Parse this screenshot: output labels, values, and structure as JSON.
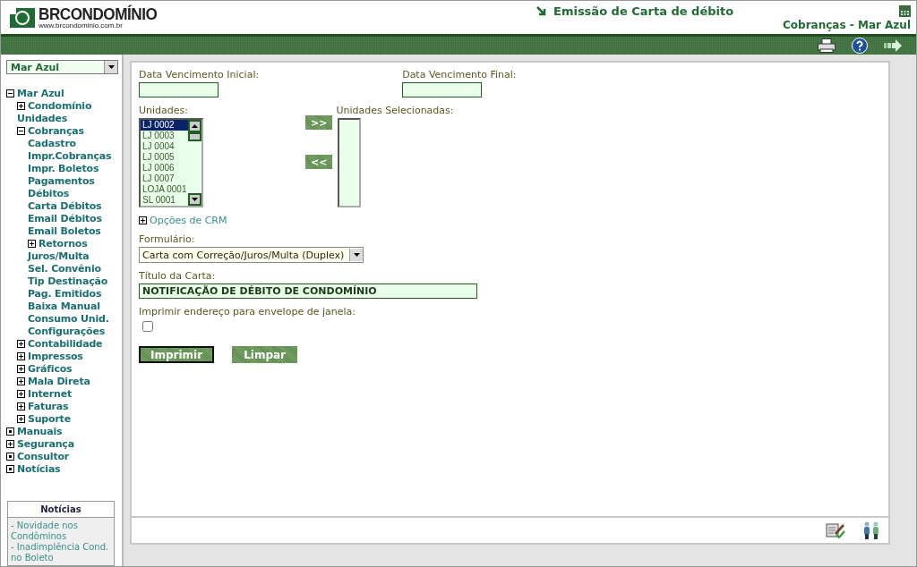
{
  "header": {
    "logo": "BRCONDOMÍNIO",
    "logo_url": "www.brcondominio.com.br",
    "title": "Emissão de Carta de débito",
    "subtitle": "Cobranças - Mar Azul"
  },
  "sidebar": {
    "condo_select": "Mar Azul",
    "tree": [
      {
        "label": "Mar Azul",
        "kind": "folder",
        "expanded": true,
        "children": [
          {
            "label": "Condomínio",
            "kind": "folder",
            "expanded": false
          },
          {
            "label": "Unidades",
            "kind": "link"
          },
          {
            "label": "Cobranças",
            "kind": "folder",
            "expanded": true,
            "children": [
              {
                "label": "Cadastro",
                "kind": "link"
              },
              {
                "label": "Impr.Cobranças",
                "kind": "link"
              },
              {
                "label": "Impr. Boletos",
                "kind": "link"
              },
              {
                "label": "Pagamentos",
                "kind": "link"
              },
              {
                "label": "Débitos",
                "kind": "link"
              },
              {
                "label": "Carta Débitos",
                "kind": "link"
              },
              {
                "label": "Email Débitos",
                "kind": "link"
              },
              {
                "label": "Email Boletos",
                "kind": "link"
              },
              {
                "label": "Retornos",
                "kind": "folder",
                "expanded": false
              },
              {
                "label": "Juros/Multa",
                "kind": "link"
              },
              {
                "label": "Sel. Convênio",
                "kind": "link"
              },
              {
                "label": "Tip Destinação",
                "kind": "link"
              },
              {
                "label": "Pag. Emitidos",
                "kind": "link"
              },
              {
                "label": "Baixa Manual",
                "kind": "link"
              },
              {
                "label": "Consumo Unid.",
                "kind": "link"
              },
              {
                "label": "Configurações",
                "kind": "link"
              }
            ]
          },
          {
            "label": "Contabilidade",
            "kind": "folder",
            "expanded": false
          },
          {
            "label": "Impressos",
            "kind": "folder",
            "expanded": false
          },
          {
            "label": "Gráficos",
            "kind": "folder",
            "expanded": false
          },
          {
            "label": "Mala Direta",
            "kind": "folder",
            "expanded": false
          },
          {
            "label": "Internet",
            "kind": "folder",
            "expanded": false
          },
          {
            "label": "Faturas",
            "kind": "folder",
            "expanded": false
          },
          {
            "label": "Suporte",
            "kind": "folder",
            "expanded": false
          }
        ]
      },
      {
        "label": "Manuais",
        "kind": "page"
      },
      {
        "label": "Segurança",
        "kind": "folder",
        "expanded": false
      },
      {
        "label": "Consultor",
        "kind": "page"
      },
      {
        "label": "Notícias",
        "kind": "page"
      }
    ],
    "news": {
      "title": "Notícias",
      "items": [
        "- Novidade nos Condôminos",
        "- Inadimplência Cond. no Boleto"
      ]
    }
  },
  "form": {
    "date_start": {
      "label": "Data Vencimento Inicial:"
    },
    "date_end": {
      "label": "Data Vencimento Final:"
    },
    "units": {
      "label": "Unidades:",
      "items": [
        {
          "label": "LJ 0002",
          "selected": true
        },
        {
          "label": "LJ 0003",
          "selected": false
        },
        {
          "label": "LJ 0004",
          "selected": false
        },
        {
          "label": "LJ 0005",
          "selected": false
        },
        {
          "label": "LJ 0006",
          "selected": false
        },
        {
          "label": "LJ 0007",
          "selected": false
        },
        {
          "label": "LOJA 0001",
          "selected": false
        },
        {
          "label": "SL 0001",
          "selected": false
        }
      ]
    },
    "add_button": ">>",
    "remove_button": "<<",
    "selected_units": {
      "label": "Unidades Selecionadas:"
    },
    "crm": {
      "label": "Opções de CRM",
      "expanded": false
    },
    "template": {
      "label": "Formulário:",
      "value": "Carta com Correção/Juros/Multa (Duplex)"
    },
    "letter_title": {
      "label": "Título da Carta:",
      "value": "NOTIFICAÇÃO DE DÉBITO DE CONDOMÍNIO"
    },
    "window_envelope": {
      "label": "Imprimir endereço para envelope de janela:",
      "checked": false
    },
    "buttons": [
      {
        "label": "Imprimir",
        "focused": true
      },
      {
        "label": "Limpar",
        "focused": false
      }
    ]
  }
}
